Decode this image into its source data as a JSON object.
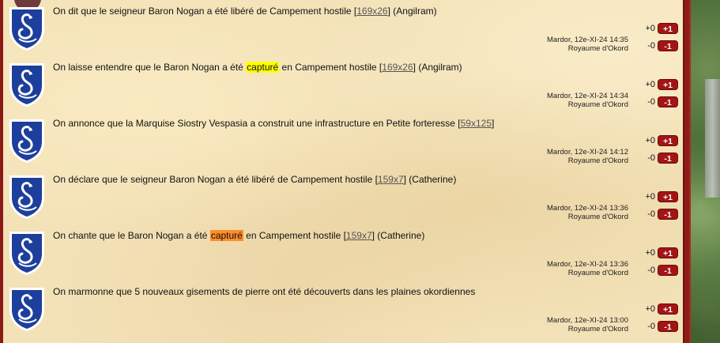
{
  "colors": {
    "panel_bg": "#f3e2b8",
    "border_red": "#8f1b16",
    "vote_button": "#a31515",
    "crest_blue": "#1d3f9c",
    "highlight_yellow": "#ffff00",
    "highlight_orange": "#ff8c2a"
  },
  "news": [
    {
      "icon": "swan-crest-icon",
      "before": "On dit que le seigneur Baron Nogan a été libéré de Campement hostile [",
      "highlight": "",
      "highlight_color": "",
      "after": "",
      "coord": "169x26",
      "tail": "] (Angilram)",
      "author": "Mardor, 12e-XI-24 14:35",
      "realm": "Royaume d'Okord",
      "plus_count": "+0",
      "minus_count": "-0",
      "plus_label": "+1",
      "minus_label": "-1"
    },
    {
      "icon": "swan-crest-icon",
      "before": "On laisse entendre que le Baron Nogan a été ",
      "highlight": "capturé",
      "highlight_color": "#ffff00",
      "after": " en Campement hostile [",
      "coord": "169x26",
      "tail": "] (Angilram)",
      "author": "Mardor, 12e-XI-24 14:34",
      "realm": "Royaume d'Okord",
      "plus_count": "+0",
      "minus_count": "-0",
      "plus_label": "+1",
      "minus_label": "-1"
    },
    {
      "icon": "swan-crest-icon",
      "before": "On annonce que la Marquise Siostry Vespasia a construit une infrastructure en Petite forteresse [",
      "highlight": "",
      "highlight_color": "",
      "after": "",
      "coord": "59x125",
      "tail": "]",
      "author": "Mardor, 12e-XI-24 14:12",
      "realm": "Royaume d'Okord",
      "plus_count": "+0",
      "minus_count": "-0",
      "plus_label": "+1",
      "minus_label": "-1"
    },
    {
      "icon": "swan-crest-icon",
      "before": "On déclare que le seigneur Baron Nogan a été libéré de Campement hostile [",
      "highlight": "",
      "highlight_color": "",
      "after": "",
      "coord": "159x7",
      "tail": "] (Catherine)",
      "author": "Mardor, 12e-XI-24 13:36",
      "realm": "Royaume d'Okord",
      "plus_count": "+0",
      "minus_count": "-0",
      "plus_label": "+1",
      "minus_label": "-1"
    },
    {
      "icon": "swan-crest-icon",
      "before": "On chante que le Baron Nogan a été ",
      "highlight": "capturé",
      "highlight_color": "#ff8c2a",
      "after": " en Campement hostile [",
      "coord": "159x7",
      "tail": "] (Catherine)",
      "author": "Mardor, 12e-XI-24 13:36",
      "realm": "Royaume d'Okord",
      "plus_count": "+0",
      "minus_count": "-0",
      "plus_label": "+1",
      "minus_label": "-1"
    },
    {
      "icon": "swan-crest-icon",
      "before": "On marmonne que 5 nouveaux gisements de pierre ont été découverts dans les plaines okordiennes",
      "highlight": "",
      "highlight_color": "",
      "after": "",
      "coord": "",
      "tail": "",
      "author": "Mardor, 12e-XI-24 13:00",
      "realm": "Royaume d'Okord",
      "plus_count": "+0",
      "minus_count": "-0",
      "plus_label": "+1",
      "minus_label": "-1"
    }
  ]
}
